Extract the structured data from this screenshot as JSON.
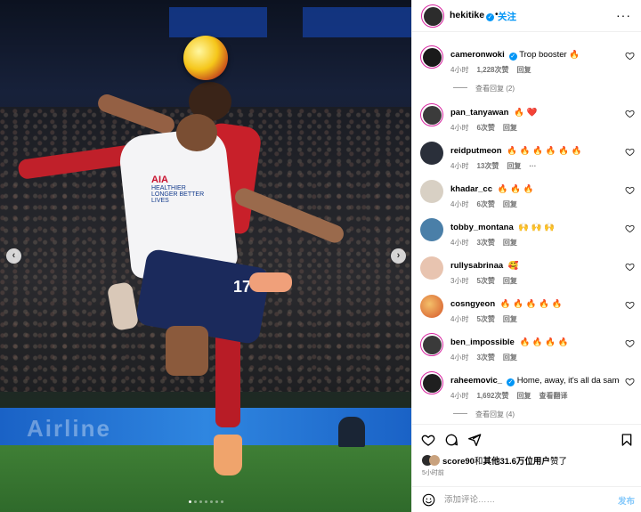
{
  "photo": {
    "shirt_sponsor": "AIA",
    "shirt_sponsor_sub": "HEALTHIER LONGER BETTER LIVES",
    "shorts_number": "17",
    "ad_text": "Airline",
    "prev_icon": "chevron-left-icon",
    "next_icon": "chevron-right-icon"
  },
  "header": {
    "username": "hekitike",
    "dot": "•",
    "follow_label": "关注",
    "more_label": "···"
  },
  "comments": [
    {
      "user": "cameronwoki",
      "verified": true,
      "text": "Trop booster 🔥",
      "time": "4小时",
      "likes": "1,228次赞",
      "reply": "回复",
      "extra": "",
      "avatar_color": "#1a1a1a"
    },
    {
      "user": "pan_tanyawan",
      "verified": false,
      "text": "🔥 ❤️",
      "time": "4小时",
      "likes": "6次赞",
      "reply": "回复",
      "extra": "",
      "avatar_color": "#3b3b3b"
    },
    {
      "user": "reidputmeon",
      "verified": false,
      "text": "🔥 🔥 🔥 🔥 🔥 🔥",
      "time": "4小时",
      "likes": "13次赞",
      "reply": "回复",
      "extra": "···",
      "avatar_color": "#2a2f3a"
    },
    {
      "user": "khadar_cc",
      "verified": false,
      "text": "🔥 🔥 🔥",
      "time": "4小时",
      "likes": "6次赞",
      "reply": "回复",
      "extra": "",
      "avatar_color": "#d8d0c4"
    },
    {
      "user": "tobby_montana",
      "verified": false,
      "text": "🙌 🙌 🙌",
      "time": "4小时",
      "likes": "3次赞",
      "reply": "回复",
      "extra": "",
      "avatar_color": "#4a7fa8"
    },
    {
      "user": "rullysabrinaa",
      "verified": false,
      "text": "🥰",
      "time": "3小时",
      "likes": "5次赞",
      "reply": "回复",
      "extra": "",
      "avatar_color": "#e8c4b0"
    },
    {
      "user": "cosngyeon",
      "verified": false,
      "text": "🔥 🔥 🔥 🔥 🔥",
      "time": "4小时",
      "likes": "5次赞",
      "reply": "回复",
      "extra": "",
      "avatar_color": "#d5562a"
    },
    {
      "user": "ben_impossible",
      "verified": false,
      "text": "🔥 🔥 🔥 🔥",
      "time": "4小时",
      "likes": "3次赞",
      "reply": "回复",
      "extra": "",
      "avatar_color": "#3a3a3a"
    },
    {
      "user": "raheemovic_",
      "verified": true,
      "text": "Home, away, it's all da same 🔥",
      "time": "4小时",
      "likes": "1,692次赞",
      "reply": "回复",
      "extra": "查看翻译",
      "avatar_color": "#1f1f1f"
    }
  ],
  "view_replies": [
    {
      "label": "查看回复 (2)"
    },
    {
      "label": "查看回复 (4)"
    }
  ],
  "actions": {
    "like_icon": "heart-icon",
    "comment_icon": "comment-icon",
    "share_icon": "send-icon",
    "save_icon": "bookmark-icon",
    "likers_user": "score90",
    "likers_connector": "和",
    "likers_others": "其他31.6万位用户",
    "likers_suffix": "赞了",
    "time": "5小时前"
  },
  "add_comment": {
    "placeholder": "添加评论……",
    "post_label": "发布"
  },
  "colors": {
    "accent": "#0095f6",
    "post_disabled": "#85c9fb",
    "meta_gray": "#737373"
  }
}
